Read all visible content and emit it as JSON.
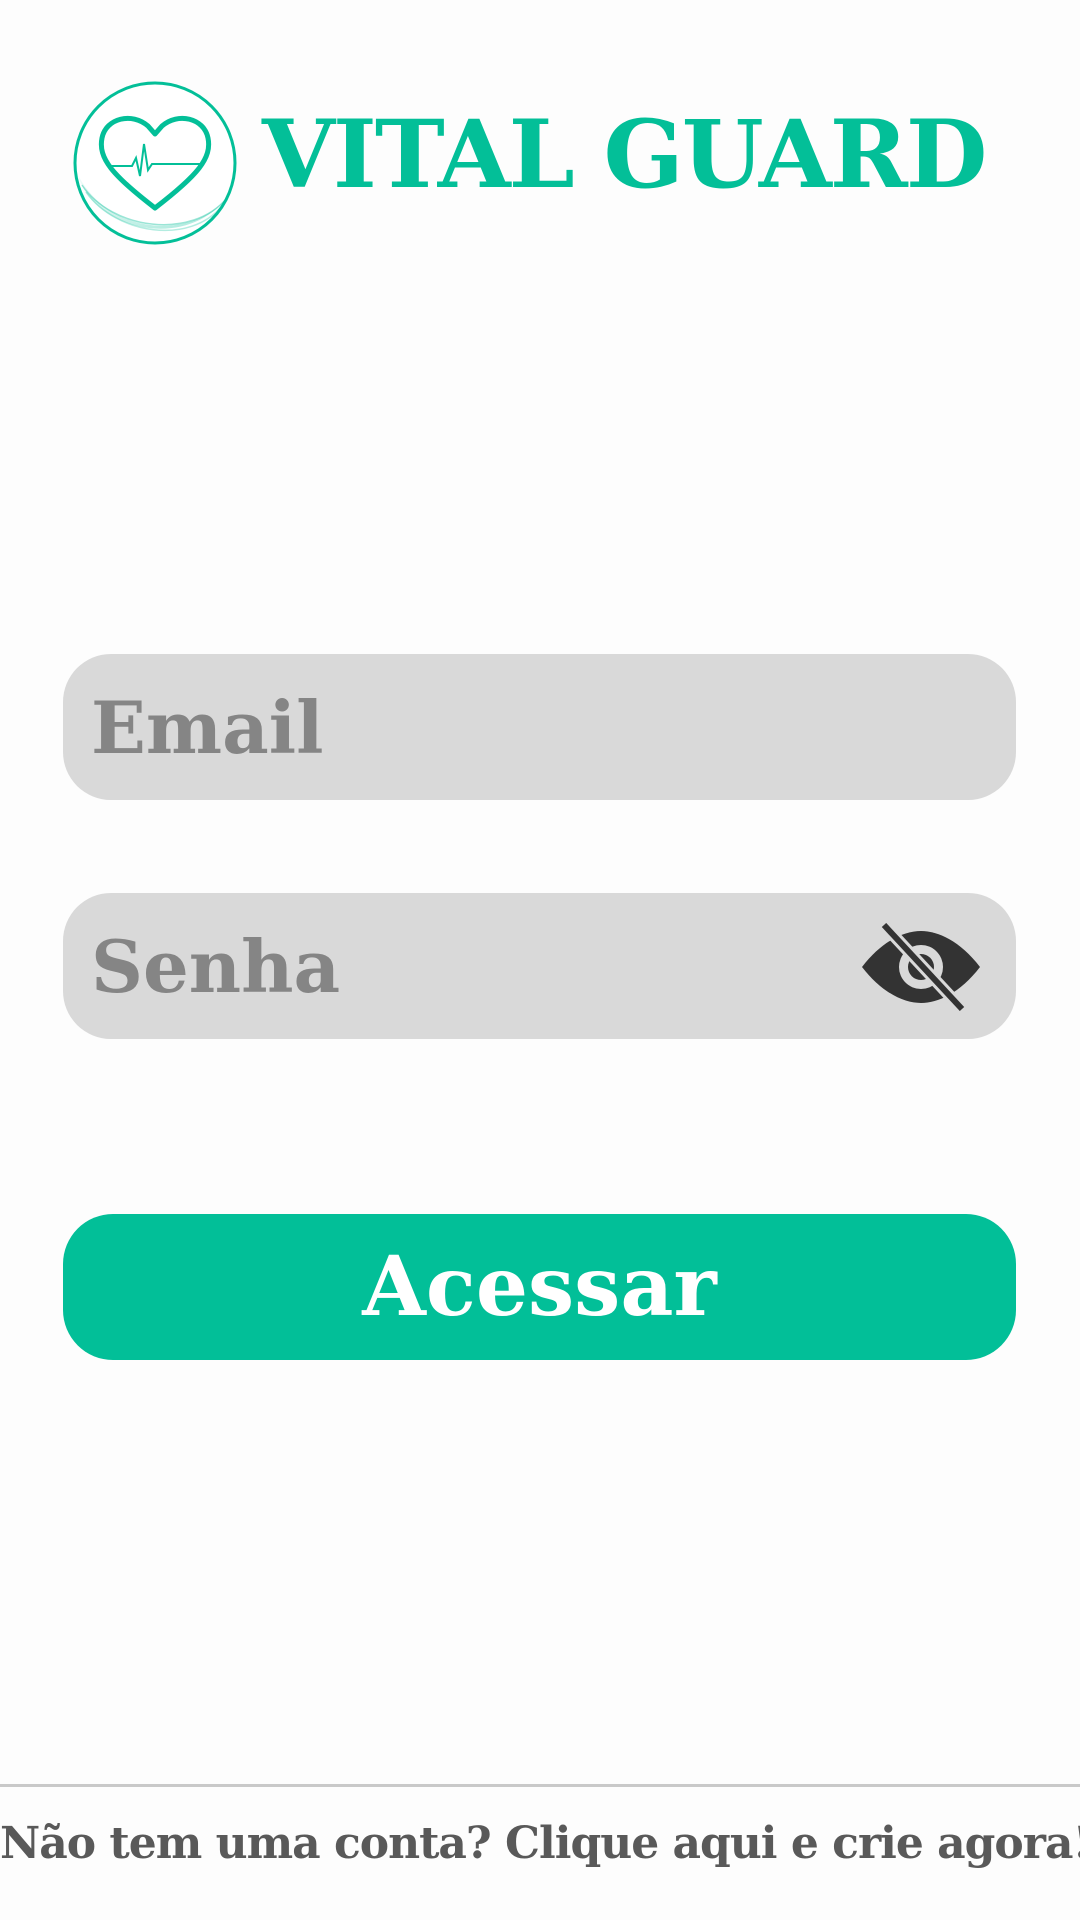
{
  "brand": {
    "name": "VITAL GUARD",
    "logo_icon": "heart-pulse-icon",
    "accent_color": "#03bf98"
  },
  "login_form": {
    "email": {
      "placeholder": "Email",
      "value": ""
    },
    "password": {
      "placeholder": "Senha",
      "value": "",
      "visibility_icon": "eye-off-icon"
    },
    "submit_label": "Acessar"
  },
  "footer": {
    "signup_text": "Não tem uma conta? Clique aqui e crie agora!",
    "text_color": "#595959"
  }
}
